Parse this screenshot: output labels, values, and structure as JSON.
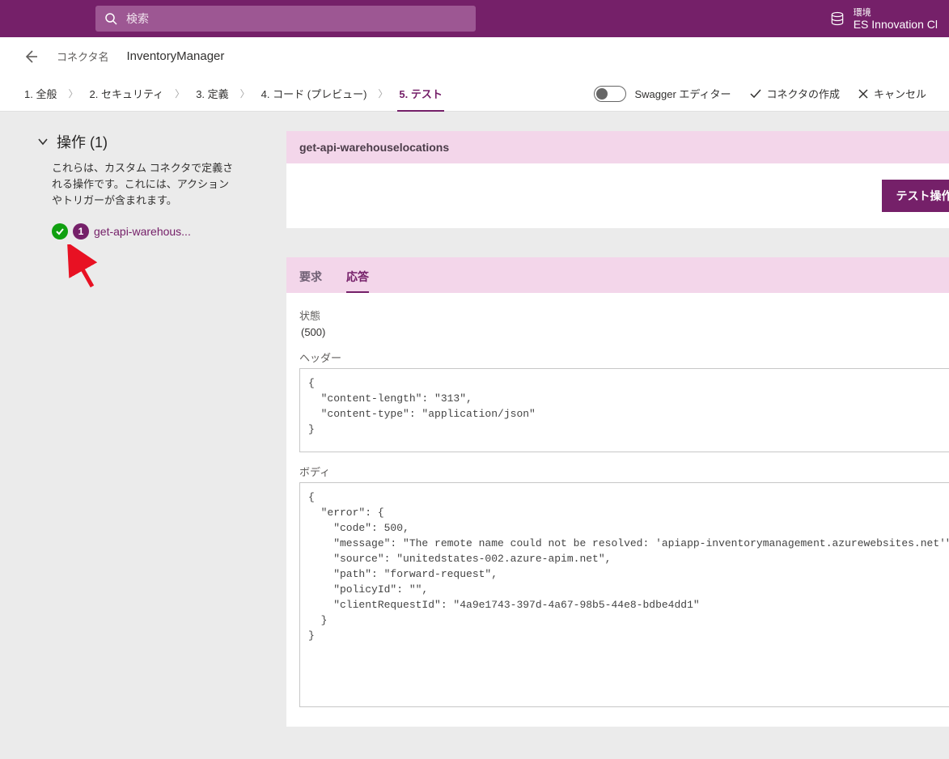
{
  "topbar": {
    "search_placeholder": "検索",
    "env_label": "環境",
    "env_name": "ES Innovation Cl"
  },
  "header": {
    "connector_label": "コネクタ名",
    "connector_name": "InventoryManager"
  },
  "wizard": {
    "t1": "1. 全般",
    "t2": "2. セキュリティ",
    "t3": "3. 定義",
    "t4": "4. コード (プレビュー)",
    "t5": "5. テスト"
  },
  "actions": {
    "swagger": "Swagger エディター",
    "create": "コネクタの作成",
    "cancel": "キャンセル"
  },
  "sidebar": {
    "heading": "操作 (1)",
    "desc": "これらは、カスタム コネクタで定義される操作です。これには、アクションやトリガーが含まれます。",
    "op_badge": "1",
    "op_name": "get-api-warehous..."
  },
  "op_panel": {
    "title": "get-api-warehouselocations",
    "test_btn": "テスト操作"
  },
  "resp": {
    "tab_req": "要求",
    "tab_resp": "応答",
    "label_status": "状態",
    "status_value": "(500)",
    "label_header": "ヘッダー",
    "header_value": "{\n  \"content-length\": \"313\",\n  \"content-type\": \"application/json\"\n}",
    "label_body": "ボディ",
    "body_value": "{\n  \"error\": {\n    \"code\": 500,\n    \"message\": \"The remote name could not be resolved: 'apiapp-inventorymanagement.azurewebsites.net'\",\n    \"source\": \"unitedstates-002.azure-apim.net\",\n    \"path\": \"forward-request\",\n    \"policyId\": \"\",\n    \"clientRequestId\": \"4a9e1743-397d-4a67-98b5-44e8-bdbe4dd1\"\n  }\n}"
  }
}
